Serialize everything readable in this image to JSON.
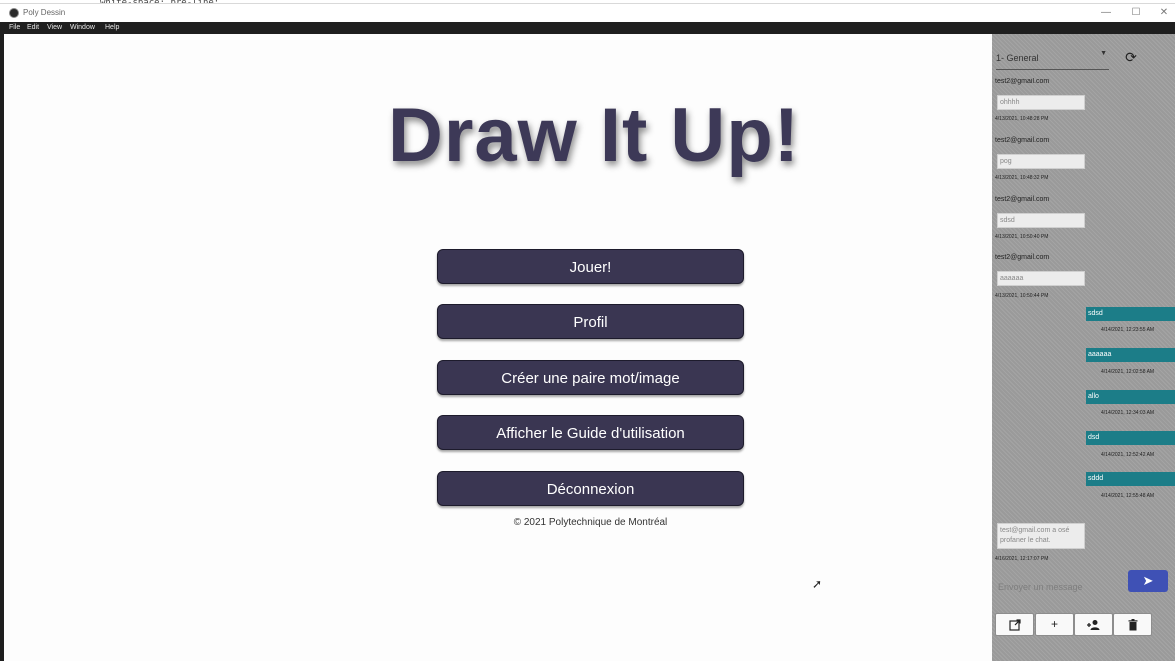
{
  "window": {
    "title": "Poly Dessin",
    "minimize": "—",
    "maximize": "☐",
    "close": "✕"
  },
  "background_code": "white-space: pre-line;",
  "menu": [
    "File",
    "Edit",
    "View",
    "Window",
    "Help"
  ],
  "main": {
    "title": "Draw It Up!",
    "buttons": [
      "Jouer!",
      "Profil",
      "Créer une paire mot/image",
      "Afficher le Guide d'utilisation",
      "Déconnexion"
    ],
    "footer": "© 2021 Polytechnique de Montréal"
  },
  "chat": {
    "channel": "1- General",
    "incoming": [
      {
        "sender": "test2@gmail.com",
        "text": "ohhhh",
        "time": "4/13/2021, 10:48:28 PM"
      },
      {
        "sender": "test2@gmail.com",
        "text": "pog",
        "time": "4/13/2021, 10:48:32 PM"
      },
      {
        "sender": "test2@gmail.com",
        "text": "sdsd",
        "time": "4/13/2021, 10:50:40 PM"
      },
      {
        "sender": "test2@gmail.com",
        "text": "aaaaaa",
        "time": "4/13/2021, 10:50:44 PM"
      }
    ],
    "outgoing": [
      {
        "text": "sdsd",
        "time": "4/14/2021, 12:23:55 AM"
      },
      {
        "text": "aaaaaa",
        "time": "4/14/2021, 12:02:58 AM"
      },
      {
        "text": "allo",
        "time": "4/14/2021, 12:34:03 AM"
      },
      {
        "text": "dsd",
        "time": "4/14/2021, 12:52:42 AM"
      },
      {
        "text": "sddd",
        "time": "4/14/2021, 12:55:48 AM"
      }
    ],
    "system": {
      "text": "test@gmail.com a osé profaner le chat.",
      "time": "4/16/2021, 12:17:07 PM"
    },
    "input_placeholder": "Envoyer un message",
    "icons": {
      "refresh": "refresh-icon",
      "send": "send-icon",
      "toolbar": [
        "open-external-icon",
        "add-icon",
        "add-user-icon",
        "delete-icon"
      ]
    }
  }
}
